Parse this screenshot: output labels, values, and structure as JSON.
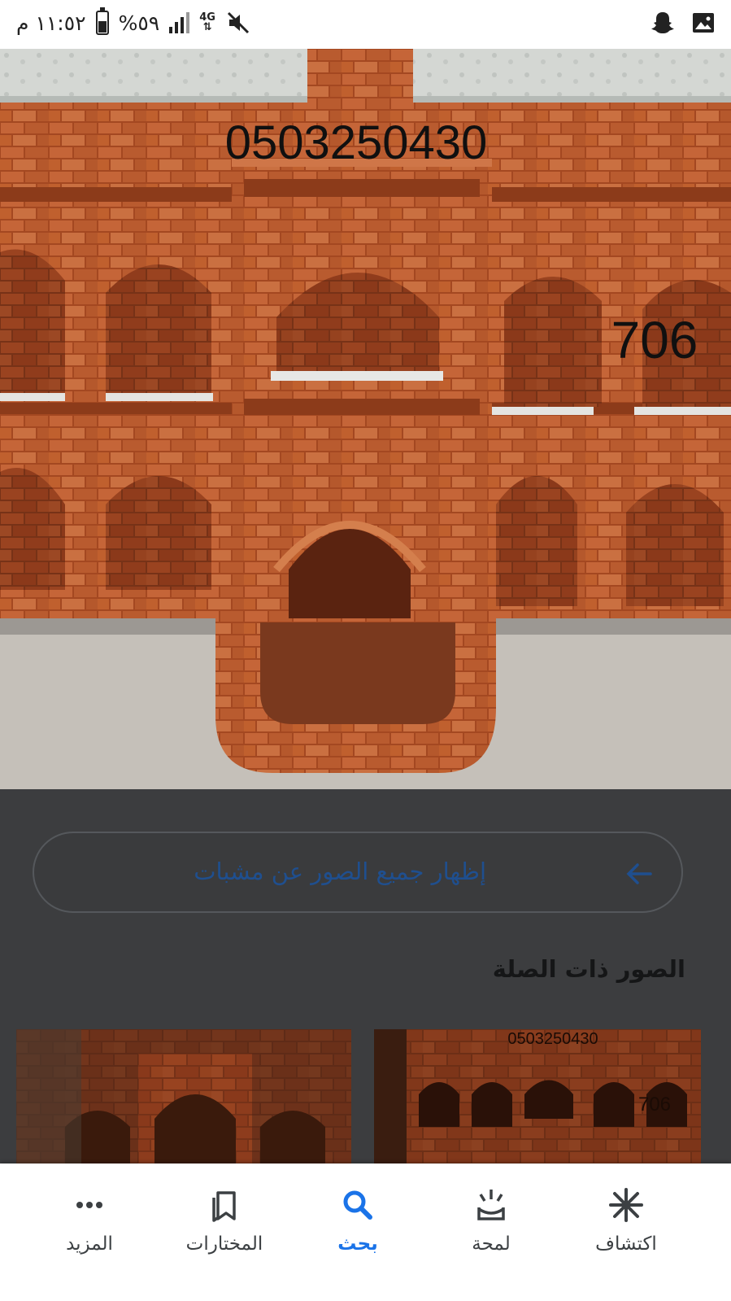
{
  "status_bar": {
    "time": "١١:٥٢ م",
    "battery": "%٥٩",
    "battery_level": 0.59,
    "network": "4G"
  },
  "hero_image": {
    "phone_number": "0503250430",
    "number": "706"
  },
  "show_all": {
    "label": "إظهار جميع الصور عن مشبات"
  },
  "related": {
    "title": "الصور ذات الصلة",
    "thumbs": [
      {
        "overlay_phone": "",
        "overlay_number": ""
      },
      {
        "overlay_phone": "0503250430",
        "overlay_number": "706"
      }
    ]
  },
  "bottom_nav": {
    "items": [
      {
        "label": "المزيد",
        "icon": "more-dots-icon"
      },
      {
        "label": "المختارات",
        "icon": "bookmarks-icon"
      },
      {
        "label": "بحث",
        "icon": "search-icon",
        "active": true
      },
      {
        "label": "لمحة",
        "icon": "snapshot-icon"
      },
      {
        "label": "اكتشاف",
        "icon": "discover-asterisk-icon"
      }
    ]
  },
  "colors": {
    "accent": "#1a73e8",
    "overlay_dim": "#3c3d3f",
    "brick": "#b8582c"
  }
}
